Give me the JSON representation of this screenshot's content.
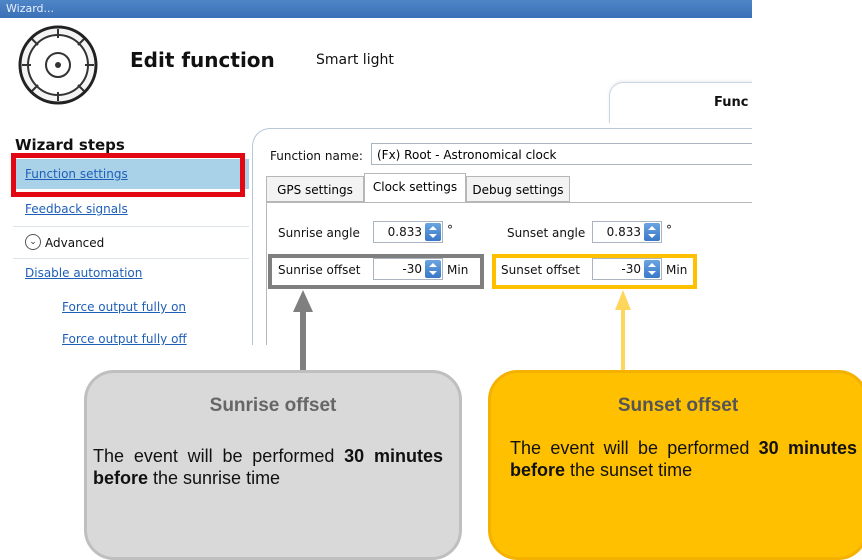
{
  "window": {
    "title": "Wizard..."
  },
  "header": {
    "title": "Edit function",
    "subtitle": "Smart light",
    "tab_partial": "Func",
    "logo_icon": "compass-dial-icon"
  },
  "sidebar": {
    "heading": "Wizard steps",
    "items": [
      {
        "label": "Function settings"
      },
      {
        "label": "Feedback signals"
      },
      {
        "label": "Advanced"
      },
      {
        "label": "Disable automation"
      },
      {
        "label": "Force output fully on"
      },
      {
        "label": "Force output fully off"
      }
    ]
  },
  "main": {
    "function_name_label": "Function name:",
    "function_name_value": "(Fx) Root - Astronomical clock",
    "tabs": [
      {
        "label": "GPS settings",
        "active": false
      },
      {
        "label": "Clock settings",
        "active": true
      },
      {
        "label": "Debug settings",
        "active": false
      }
    ],
    "clock": {
      "sunrise_angle_label": "Sunrise angle",
      "sunrise_angle_value": "0.833",
      "sunset_angle_label": "Sunset angle",
      "sunset_angle_value": "0.833",
      "degree_unit": "°",
      "sunrise_offset_label": "Sunrise offset",
      "sunrise_offset_value": "-30",
      "sunset_offset_label": "Sunset offset",
      "sunset_offset_value": "-30",
      "offset_unit": "Min"
    }
  },
  "callouts": {
    "sunrise": {
      "title": "Sunrise offset",
      "text_before": "The event will be performed ",
      "text_bold": "30 minutes before",
      "text_after": " the sunrise time"
    },
    "sunset": {
      "title": "Sunset offset",
      "text_before": "The event will be performed ",
      "text_bold": "30 minutes before",
      "text_after": " the sunset time"
    }
  },
  "colors": {
    "highlight_red": "#e30613",
    "highlight_gray": "#7f7f7f",
    "highlight_yellow": "#ffc000",
    "selected_item": "#a9d2e8",
    "link": "#1f5fb8"
  }
}
